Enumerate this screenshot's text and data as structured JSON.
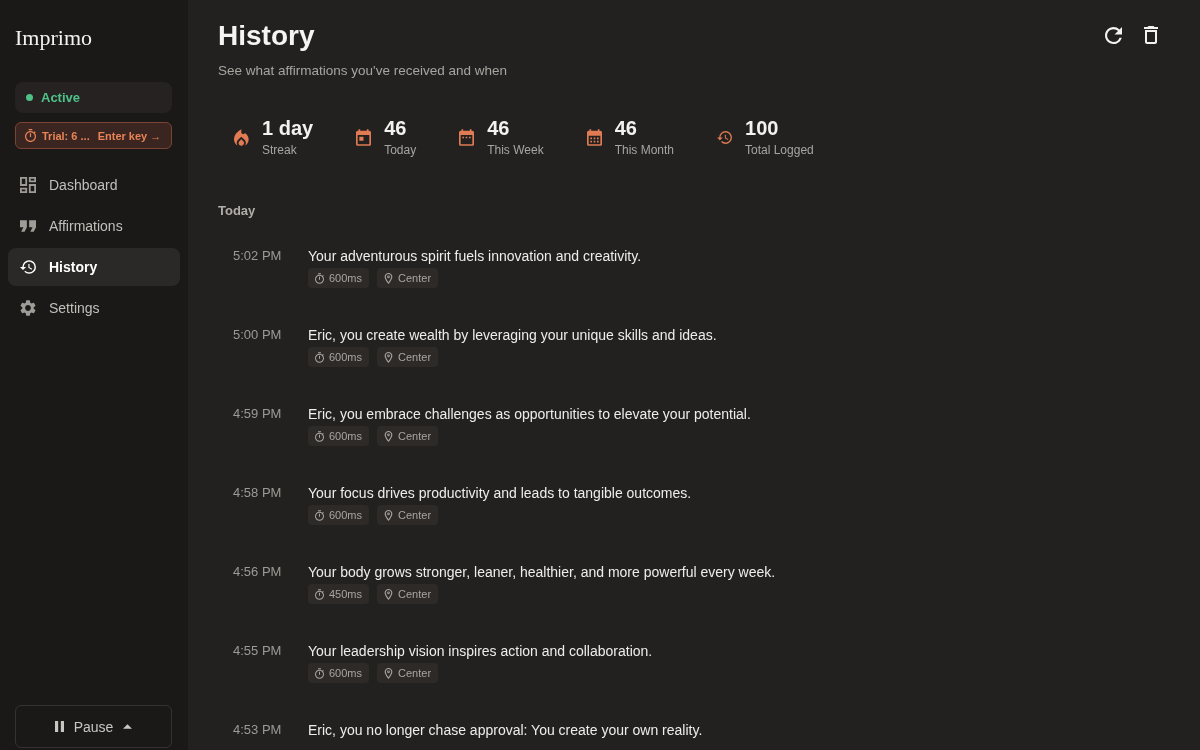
{
  "sidebar": {
    "app_name": "Imprimo",
    "status": {
      "label": "Active",
      "active": true
    },
    "trial": {
      "label": "Trial: 6 ...",
      "action": "Enter key →"
    },
    "nav": [
      {
        "label": "Dashboard",
        "selected": false
      },
      {
        "label": "Affirmations",
        "selected": false
      },
      {
        "label": "History",
        "selected": true
      },
      {
        "label": "Settings",
        "selected": false
      }
    ],
    "pause_button": {
      "label": "Pause"
    }
  },
  "header": {
    "title": "History",
    "subtitle": "See what affirmations you've received and when"
  },
  "stats": [
    {
      "value": "1 day",
      "label": "Streak"
    },
    {
      "value": "46",
      "label": "Today"
    },
    {
      "value": "46",
      "label": "This Week"
    },
    {
      "value": "46",
      "label": "This Month"
    },
    {
      "value": "100",
      "label": "Total Logged"
    }
  ],
  "sections": [
    {
      "heading": "Today",
      "entries": [
        {
          "time": "5:02 PM",
          "text": "Your adventurous spirit fuels innovation and creativity.",
          "duration": "600ms",
          "position": "Center"
        },
        {
          "time": "5:00 PM",
          "text": "Eric, you create wealth by leveraging your unique skills and ideas.",
          "duration": "600ms",
          "position": "Center"
        },
        {
          "time": "4:59 PM",
          "text": "Eric, you embrace challenges as opportunities to elevate your potential.",
          "duration": "600ms",
          "position": "Center"
        },
        {
          "time": "4:58 PM",
          "text": "Your focus drives productivity and leads to tangible outcomes.",
          "duration": "600ms",
          "position": "Center"
        },
        {
          "time": "4:56 PM",
          "text": "Your body grows stronger, leaner, healthier, and more powerful every week.",
          "duration": "450ms",
          "position": "Center"
        },
        {
          "time": "4:55 PM",
          "text": "Your leadership vision inspires action and collaboration.",
          "duration": "600ms",
          "position": "Center"
        },
        {
          "time": "4:53 PM",
          "text": "Eric, you no longer chase approval: You create your own reality."
        }
      ]
    }
  ]
}
